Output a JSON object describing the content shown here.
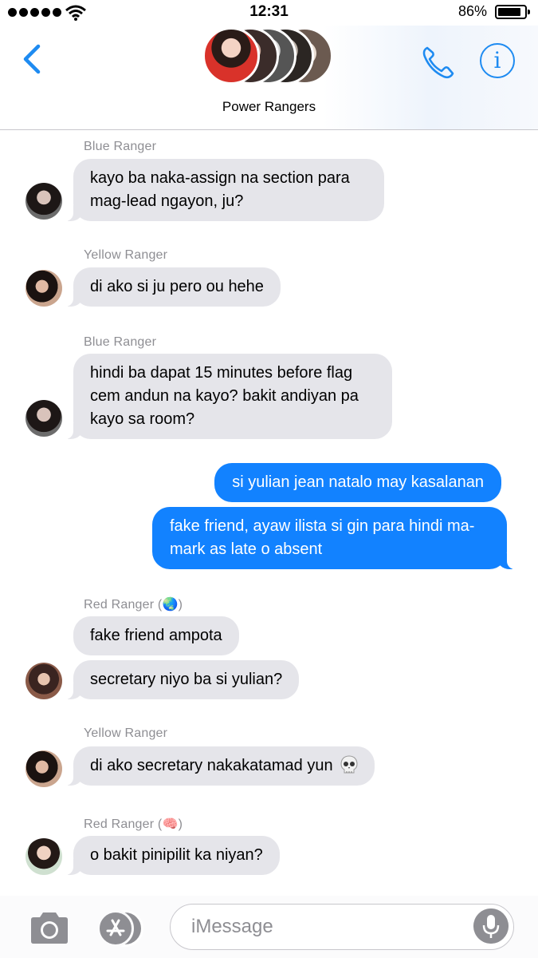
{
  "status_bar": {
    "time": "12:31",
    "battery_percent": "86%",
    "battery_level": 0.86,
    "signal_bars": 5
  },
  "header": {
    "group_name": "Power Rangers"
  },
  "messages": [
    {
      "sender": "Blue Ranger",
      "text": "kayo ba naka-assign na section para mag-lead ngayon, ju?"
    },
    {
      "sender": "Yellow Ranger",
      "text": "di ako si ju pero ou hehe"
    },
    {
      "sender": "Blue Ranger",
      "text": "hindi ba dapat 15 minutes before flag cem andun na kayo? bakit andiyan pa kayo sa room?"
    },
    {
      "sender": "",
      "text": "si yulian jean natalo may kasalanan"
    },
    {
      "sender": "",
      "text": "fake friend, ayaw ilista si gin para hindi ma-mark as late o absent"
    },
    {
      "sender": "Red Ranger (🌏)",
      "text": "fake friend ampota"
    },
    {
      "sender": "",
      "text": "secretary niyo ba si yulian?"
    },
    {
      "sender": "Yellow Ranger",
      "text": "di ako secretary nakakatamad yun"
    },
    {
      "sender": "Red Ranger (🧠)",
      "text": "o bakit pinipilit ka niyan?"
    }
  ],
  "input": {
    "placeholder": "iMessage"
  },
  "colors": {
    "accent": "#1e8bf1",
    "sent_bubble": "#1282ff",
    "received_bubble": "#e5e5ea",
    "sender_label": "#8e8e93"
  }
}
